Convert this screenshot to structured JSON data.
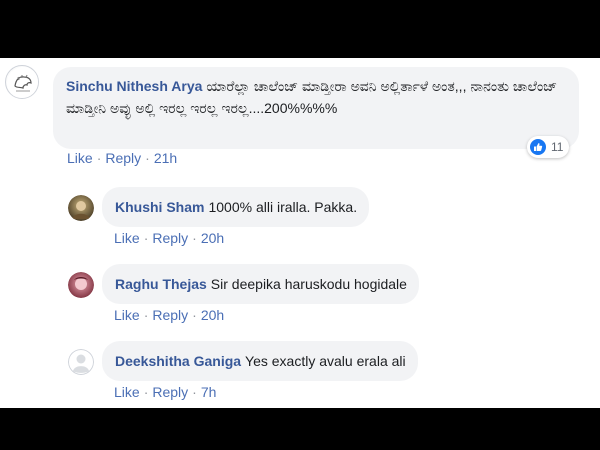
{
  "main_comment": {
    "author": "Sinchu Nithesh Arya",
    "text": "ಯಾರೆಲ್ಲಾ ಚಾಲೆಂಜ್ ಮಾಡ್ತೀರಾ ಅವನಿ ಅಲ್ಲಿರ್ತಾಳೆ ಅಂತ,,, ನಾನಂತು ಚಾಲೆಂಜ್ ಮಾಡ್ತೀನಿ ಅವ್ಳು ಅಲ್ಲಿ ಇರಲ್ಲ ಇರಲ್ಲ ಇರಲ್ಲ....200%%%%",
    "like_label": "Like",
    "reply_label": "Reply",
    "time": "21h",
    "reaction_count": "11"
  },
  "replies": [
    {
      "author": "Khushi Sham",
      "text": "1000% alli iralla. Pakka.",
      "like_label": "Like",
      "reply_label": "Reply",
      "time": "20h"
    },
    {
      "author": "Raghu Thejas",
      "text": "Sir deepika haruskodu hogidale",
      "like_label": "Like",
      "reply_label": "Reply",
      "time": "20h"
    },
    {
      "author": "Deekshitha Ganiga",
      "text": "Yes exactly avalu erala ali",
      "like_label": "Like",
      "reply_label": "Reply",
      "time": "7h"
    }
  ],
  "colors": {
    "author_link": "#385898",
    "action_link": "#4b6fb5",
    "bubble": "#f2f3f5",
    "like_blue": "#1877f2"
  },
  "icons": [
    "profile-logo-icon",
    "thumbs-up-icon",
    "user-photo-icon",
    "default-profile-icon"
  ]
}
